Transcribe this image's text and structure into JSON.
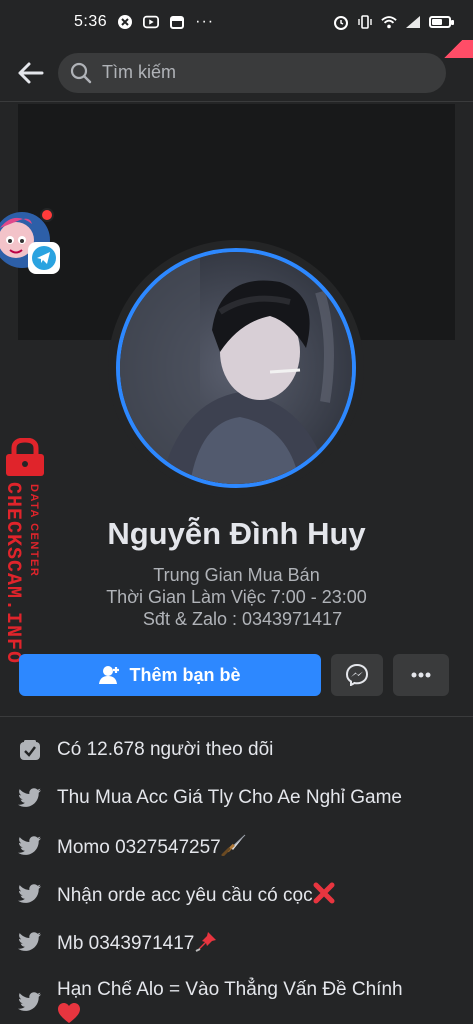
{
  "status_bar": {
    "time": "5:36",
    "battery_level": 0.6
  },
  "search": {
    "placeholder": "Tìm kiếm"
  },
  "watermark": {
    "main": "CHECKSCAM.INFO",
    "sub": "DATA CENTER"
  },
  "profile": {
    "name": "Nguyễn Đình Huy",
    "bio": [
      "Trung Gian Mua Bán",
      "Thời Gian Làm Việc 7:00 - 23:00",
      "Sđt & Zalo : 0343971417"
    ]
  },
  "actions": {
    "add_friend_label": "Thêm bạn bè"
  },
  "info": [
    {
      "icon": "followers-icon",
      "text": "Có 12.678 người theo dõi"
    },
    {
      "icon": "twitter-bird-icon",
      "text": "Thu Mua Acc Giá Tly Cho Ae Nghỉ Game"
    },
    {
      "icon": "twitter-bird-icon",
      "text": "Momo 0327547257",
      "emoji": "dagger"
    },
    {
      "icon": "twitter-bird-icon",
      "text": "Nhận orde acc yêu cầu có cọc",
      "emoji": "cross-mark"
    },
    {
      "icon": "twitter-bird-icon",
      "text": "Mb 0343971417",
      "emoji": "pushpin"
    },
    {
      "icon": "twitter-bird-icon",
      "text": "Hạn Chế Alo = Vào Thẳng Vấn Đề Chính",
      "emoji": "heart"
    }
  ],
  "colors": {
    "background": "#242526",
    "accent": "#2d88ff",
    "watermark": "#e0242b"
  }
}
